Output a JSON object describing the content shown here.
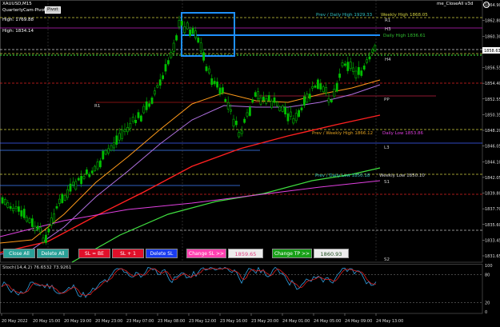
{
  "chart": {
    "symbol_title": "XAUUSD,M15",
    "ea_name": "QuarterlyCam-Pivot",
    "ea_badge": "Pivot",
    "high": "High: 1769.88",
    "high2": "High: 1834.14",
    "right_title": "me_CloseAll v3d",
    "labels": {
      "prev_daily_high": "Prev / Daily High 1929.33",
      "weekly_high": "Weekly High 1868.05",
      "daily_high": "Daily High 1836.61",
      "prev_weekly_high": "Prev / Weekly High 1866.12",
      "daily_low": "Daily Low 1853.86",
      "prev_daily_low": "Prev / Daily Low 1850.18",
      "weekly_low": "Weekly Low 1850.10",
      "r1": "R1",
      "h3": "H3",
      "h4": "H4",
      "r1b": "R1",
      "pp": "PP",
      "l3": "L3",
      "s1": "S1",
      "s2": "S2"
    },
    "price_ticks": [
      "1864.90",
      "1862.80",
      "1860.30",
      "1858.25",
      "1856.55",
      "1854.40",
      "1852.55",
      "1850.35",
      "1848.20",
      "1846.05",
      "1844.10",
      "1842.05",
      "1839.80",
      "1837.70",
      "1835.60",
      "1833.45",
      "1831.65"
    ],
    "current_price": "1858.63",
    "time_ticks": [
      "20 May 2022",
      "20 May 15:00",
      "20 May 19:00",
      "20 May 23:00",
      "23 May 07:00",
      "23 May 08:00",
      "23 May 12:00",
      "23 May 16:00",
      "23 May 20:00",
      "24 May 01:00",
      "24 May 05:00",
      "24 May 09:00",
      "24 May 13:00"
    ],
    "stoch": {
      "label": "Stoch(14,4,2) 76.6532 73.9261",
      "ticks": [
        "100",
        "80",
        "20",
        "0"
      ]
    }
  },
  "buttons": {
    "close_all": "Close All",
    "delete_all": "Delete All",
    "sl_be": "SL = BE",
    "sl_plus1": "SL + 1",
    "delete_sl": "Delete SL",
    "change_sl": "Change SL >>",
    "sl_value": "1859.65",
    "change_tp": "Change TP >>",
    "tp_value": "1860.93"
  },
  "colors": {
    "bg": "#000000",
    "candle": "#00c000",
    "ma_orange": "#ff9a1a",
    "ma_violet": "#b070e0",
    "ma_red": "#ff2020",
    "ma_green": "#40e040",
    "ma_magenta": "#e040e0",
    "btn_teal": "#2aa198",
    "btn_red": "#e0102a",
    "btn_blue": "#1a3cf0",
    "btn_pink": "#ff40b0",
    "btn_green": "#18a018",
    "box_blue": "#1e90ff"
  }
}
